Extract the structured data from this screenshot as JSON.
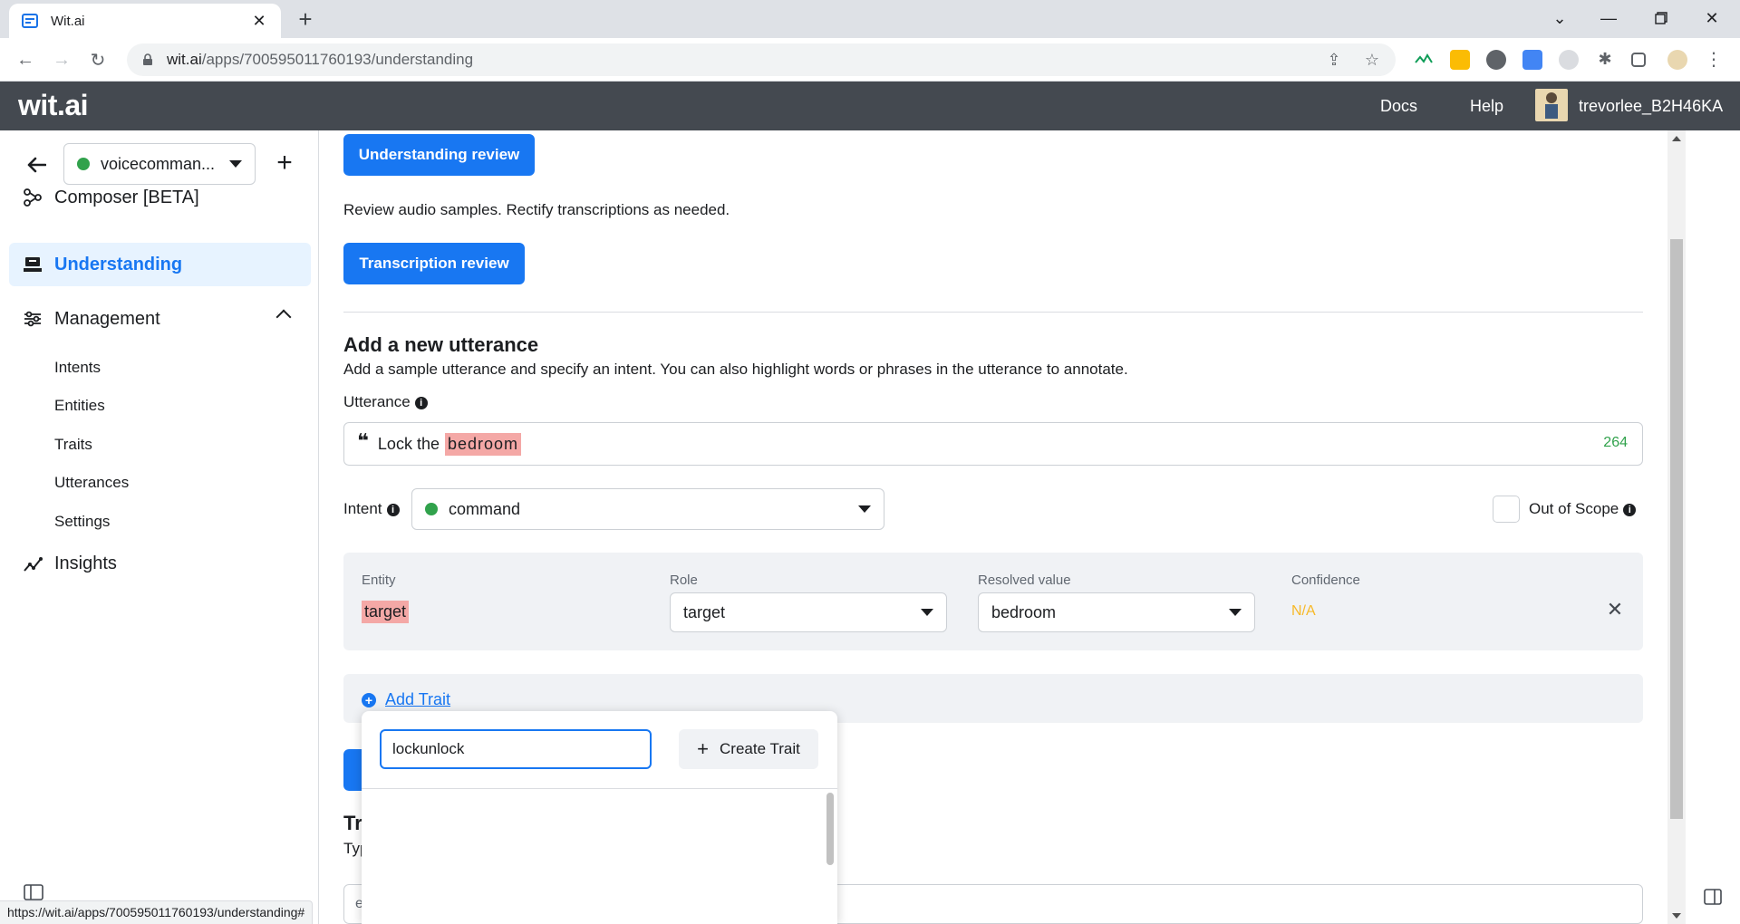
{
  "browser": {
    "tab_title": "Wit.ai",
    "url_host": "wit.ai",
    "url_path": "/apps/700595011760193/understanding",
    "status_url": "https://wit.ai/apps/700595011760193/understanding#"
  },
  "header": {
    "logo": "wit.ai",
    "docs": "Docs",
    "help": "Help",
    "username": "trevorlee_B2H46KA"
  },
  "sidebar": {
    "app_name": "voicecomman...",
    "items": [
      {
        "label": "Composer [BETA]"
      },
      {
        "label": "Understanding"
      },
      {
        "label": "Management"
      },
      {
        "label": "Insights"
      }
    ],
    "management_sub": [
      "Intents",
      "Entities",
      "Traits",
      "Utterances",
      "Settings"
    ]
  },
  "main": {
    "understanding_review_btn": "Understanding review",
    "review_desc": "Review audio samples. Rectify transcriptions as needed.",
    "transcription_review_btn": "Transcription review",
    "add_title": "Add a new utterance",
    "add_desc": "Add a sample utterance and specify an intent. You can also highlight words or phrases in the utterance to annotate.",
    "utterance_label": "Utterance",
    "utterance_text": "Lock the",
    "utterance_entity": "bedroom",
    "utterance_count": "264",
    "intent_label": "Intent",
    "intent_value": "command",
    "out_of_scope": "Out of Scope",
    "entity_panel": {
      "col_entity": "Entity",
      "col_role": "Role",
      "col_resolved": "Resolved value",
      "col_confidence": "Confidence",
      "entity": "target",
      "role": "target",
      "resolved": "bedroom",
      "confidence": "N/A"
    },
    "add_trait": "Add Trait",
    "partial_heading": "Tr",
    "partial_text": "Typ",
    "partial_input": "e"
  },
  "dropdown": {
    "search_value": "lockunlock",
    "create_btn": "Create Trait"
  },
  "colors": {
    "primary": "#1877f2",
    "header_bg": "#444950",
    "entity_highlight": "#f4a8a6",
    "green": "#31a24c",
    "confidence": "#f7b928"
  }
}
